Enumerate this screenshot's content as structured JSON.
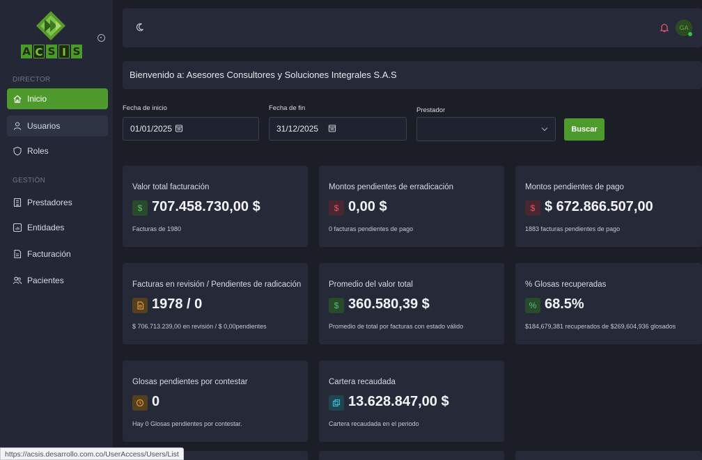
{
  "brand": {
    "logo_text": [
      "A",
      "C",
      "S",
      "I",
      "S"
    ]
  },
  "sidebar": {
    "section_director": "DIRECTOR",
    "section_gestion": "GESTIÓN",
    "items": [
      {
        "label": "Inicio",
        "icon": "home-icon"
      },
      {
        "label": "Usuarios",
        "icon": "user-icon"
      },
      {
        "label": "Roles",
        "icon": "shield-icon"
      },
      {
        "label": "Prestadores",
        "icon": "building-icon"
      },
      {
        "label": "Entidades",
        "icon": "chart-icon"
      },
      {
        "label": "Facturación",
        "icon": "invoice-icon"
      },
      {
        "label": "Pacientes",
        "icon": "users-icon"
      }
    ]
  },
  "topbar": {
    "avatar_initials": "GA"
  },
  "welcome": {
    "text": "Bienvenido a: Asesores Consultores y Soluciones Integrales S.A.S"
  },
  "filters": {
    "start_label": "Fecha de inicio",
    "start_value": "01/01/2025",
    "end_label": "Fecha de fin",
    "end_value": "31/12/2025",
    "provider_label": "Prestador",
    "search_button": "Buscar"
  },
  "cards": [
    {
      "title": "Valor total facturación",
      "badge": "$",
      "value": "707.458.730,00 $",
      "sub": "Facturas de 1980"
    },
    {
      "title": "Montos pendientes de erradicación",
      "badge": "$",
      "value": "0,00 $",
      "sub": "0 facturas pendientes de pago"
    },
    {
      "title": "Montos pendientes de pago",
      "badge": "$",
      "value": "$ 672.866.507,00",
      "sub": "1883 facturas pendientes de pago"
    },
    {
      "title": "Facturas en revisión / Pendientes de radicación",
      "badge": "doc",
      "value": "1978 / 0",
      "sub": "$ 706.713.239,00 en revisión / $ 0,00pendientes"
    },
    {
      "title": "Promedio del valor total",
      "badge": "$",
      "value": "360.580,39 $",
      "sub": "Promedio de total por facturas con estado válido"
    },
    {
      "title": "% Glosas recuperadas",
      "badge": "%",
      "value": "68.5%",
      "sub": "$184,679,381 recuperados de $269,604,936 glosados"
    },
    {
      "title": "Glosas pendientes por contestar",
      "badge": "clock",
      "value": "0",
      "sub": "Hay 0 Glosas pendientes por contestar."
    },
    {
      "title": "Cartera recaudada",
      "badge": "copy",
      "value": "13.628.847,00 $",
      "sub": "Cartera recaudada en el periodo"
    }
  ],
  "status_bar": {
    "url": "https://acsis.desarrollo.com.co/UserAccess/Users/List"
  },
  "colors": {
    "accent": "#4e9a2c",
    "sidebar_bg": "#242836",
    "card_bg": "#262a38",
    "page_bg": "#1b1e27"
  }
}
